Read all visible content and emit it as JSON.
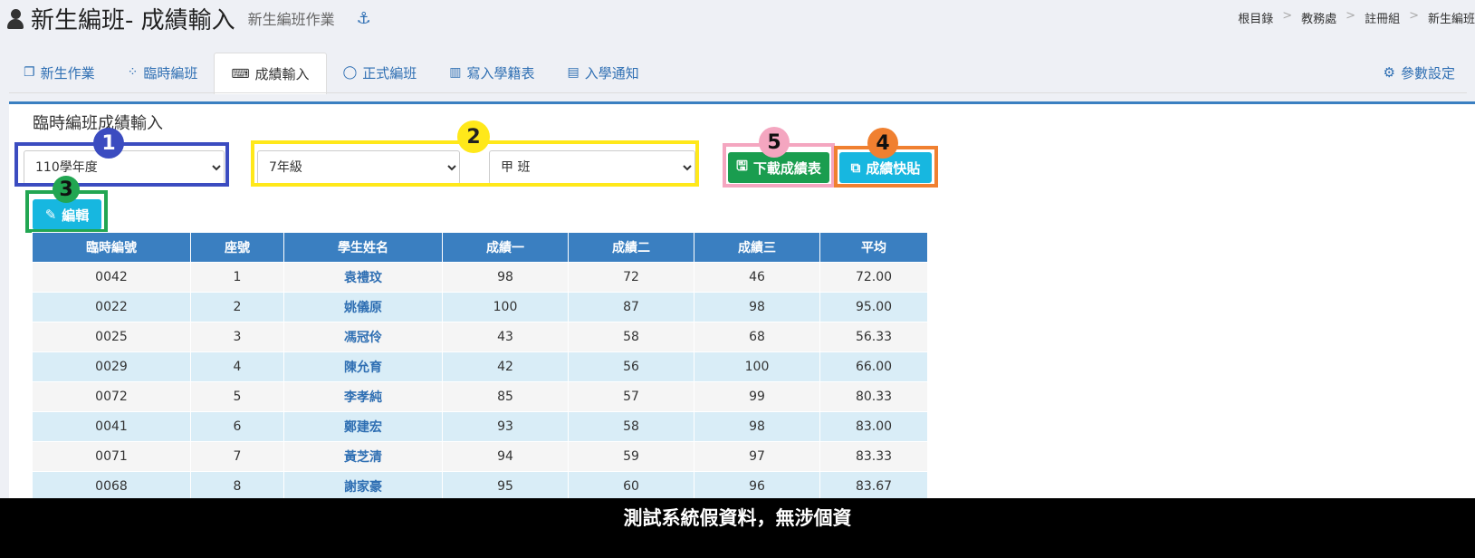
{
  "header": {
    "title": "新生編班- 成績輸入",
    "subtitle": "新生編班作業",
    "breadcrumb": [
      "根目錄",
      "教務處",
      "註冊組",
      "新生編班"
    ]
  },
  "tabs": [
    {
      "label": "新生作業",
      "icon": "copy-icon"
    },
    {
      "label": "臨時編班",
      "icon": "spinner-icon"
    },
    {
      "label": "成績輸入",
      "icon": "keyboard-icon"
    },
    {
      "label": "正式編班",
      "icon": "circle-icon"
    },
    {
      "label": "寫入學籍表",
      "icon": "map-icon"
    },
    {
      "label": "入學通知",
      "icon": "file-icon"
    }
  ],
  "settings_label": "參數設定",
  "panel": {
    "title": "臨時編班成績輸入",
    "year_select": "110學年度",
    "grade_select": "7年級",
    "class_select": "甲 班",
    "download_label": "下載成績表",
    "paste_label": "成績快貼",
    "edit_label": "編輯"
  },
  "annotations": [
    "1",
    "2",
    "3",
    "4",
    "5"
  ],
  "annotation_colors": {
    "1": "#3b4cc0",
    "2": "#ffe81a",
    "3": "#22a652",
    "4": "#f08030",
    "5": "#f4a6c0"
  },
  "table": {
    "headers": [
      "臨時編號",
      "座號",
      "學生姓名",
      "成績一",
      "成績二",
      "成績三",
      "平均"
    ],
    "rows": [
      [
        "0042",
        "1",
        "袁禮玟",
        "98",
        "72",
        "46",
        "72.00"
      ],
      [
        "0022",
        "2",
        "姚儀原",
        "100",
        "87",
        "98",
        "95.00"
      ],
      [
        "0025",
        "3",
        "馮冠伶",
        "43",
        "58",
        "68",
        "56.33"
      ],
      [
        "0029",
        "4",
        "陳允育",
        "42",
        "56",
        "100",
        "66.00"
      ],
      [
        "0072",
        "5",
        "李孝純",
        "85",
        "57",
        "99",
        "80.33"
      ],
      [
        "0041",
        "6",
        "鄭建宏",
        "93",
        "58",
        "98",
        "83.00"
      ],
      [
        "0071",
        "7",
        "黃芝清",
        "94",
        "59",
        "97",
        "83.33"
      ],
      [
        "0068",
        "8",
        "謝家豪",
        "95",
        "60",
        "96",
        "83.67"
      ]
    ]
  },
  "disclaimer": "測試系統假資料，無涉個資"
}
